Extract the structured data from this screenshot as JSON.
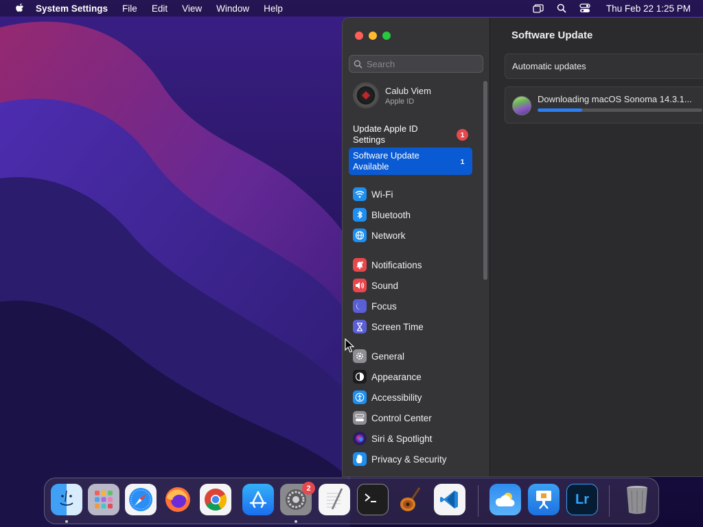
{
  "menubar": {
    "app_name": "System Settings",
    "menus": [
      "File",
      "Edit",
      "View",
      "Window",
      "Help"
    ],
    "clock": "Thu Feb 22  1:25 PM"
  },
  "window": {
    "search": {
      "placeholder": "Search",
      "value": ""
    },
    "account": {
      "name": "Calub Viem",
      "subtitle": "Apple ID"
    },
    "alerts": [
      {
        "label": "Update Apple ID Settings",
        "badge": "1"
      },
      {
        "label": "Software Update Available",
        "badge": "1"
      }
    ],
    "sidebar_items": [
      {
        "label": "Wi-Fi",
        "icon": "wifi-icon",
        "color": "#1e8ff0"
      },
      {
        "label": "Bluetooth",
        "icon": "bluetooth-icon",
        "color": "#1e8ff0"
      },
      {
        "label": "Network",
        "icon": "globe-icon",
        "color": "#1e8ff0"
      },
      {
        "label": "Notifications",
        "icon": "bell-icon",
        "color": "#e8474c"
      },
      {
        "label": "Sound",
        "icon": "speaker-icon",
        "color": "#e8474c"
      },
      {
        "label": "Focus",
        "icon": "moon-icon",
        "color": "#5b5fd6"
      },
      {
        "label": "Screen Time",
        "icon": "hourglass-icon",
        "color": "#5b5fd6"
      },
      {
        "label": "General",
        "icon": "gear-icon",
        "color": "#8e8e93"
      },
      {
        "label": "Appearance",
        "icon": "appearance-icon",
        "color": "#1c1c1e"
      },
      {
        "label": "Accessibility",
        "icon": "accessibility-icon",
        "color": "#1e8ff0"
      },
      {
        "label": "Control Center",
        "icon": "control-center-icon",
        "color": "#8e8e93"
      },
      {
        "label": "Siri & Spotlight",
        "icon": "siri-icon",
        "color": "#2a1e5a"
      },
      {
        "label": "Privacy & Security",
        "icon": "hand-icon",
        "color": "#1e8ff0"
      }
    ],
    "main": {
      "title": "Software Update",
      "automatic_updates_label": "Automatic updates",
      "download_text": "Downloading macOS Sonoma 14.3.1...",
      "download_progress": 0.27
    }
  },
  "dock": {
    "apps": [
      "Finder",
      "Launchpad",
      "Safari",
      "Firefox",
      "Chrome",
      "App Store",
      "System Settings",
      "TextEdit",
      "Terminal",
      "GarageBand",
      "Visual Studio Code",
      "Weather",
      "Keynote",
      "Lightroom",
      "Trash"
    ],
    "system_settings_badge": "2",
    "lightroom_label": "Lr"
  },
  "colors": {
    "accent": "#0a5bd3",
    "badge": "#e5484d",
    "progress": "#2a7ff5"
  }
}
